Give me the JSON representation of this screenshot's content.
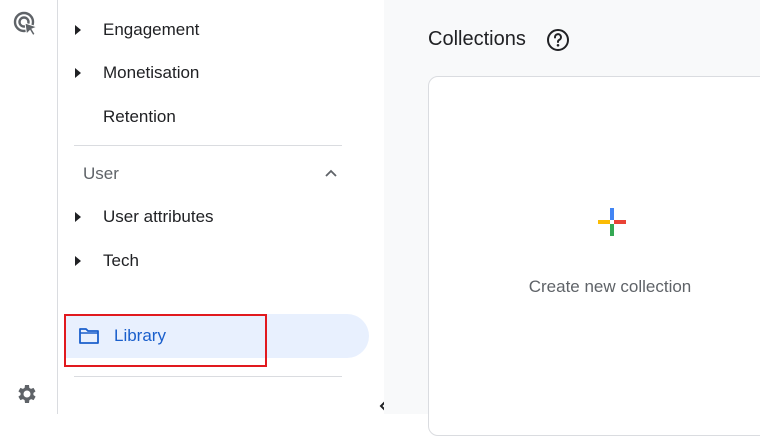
{
  "nav": {
    "items_top": [
      {
        "label": "Engagement",
        "expandable": true
      },
      {
        "label": "Monetisation",
        "expandable": true
      },
      {
        "label": "Retention",
        "expandable": false
      }
    ],
    "section": {
      "label": "User",
      "expanded": true
    },
    "items_user": [
      {
        "label": "User attributes",
        "expandable": true
      },
      {
        "label": "Tech",
        "expandable": true
      }
    ],
    "library": {
      "label": "Library",
      "selected": true
    }
  },
  "main": {
    "title": "Collections",
    "create_card": {
      "label": "Create new collection"
    }
  },
  "icons": {
    "rail_top": "analytics-cursor-icon",
    "rail_bottom": "gear-icon",
    "help": "help-circle-icon",
    "folder": "folder-icon",
    "plus": "google-plus-icon",
    "collapse": "chevron-left-icon"
  },
  "colors": {
    "selected_bg": "#e8f0fe",
    "selected_text": "#1a5fcc",
    "highlight_box": "#e1191e",
    "plus_blue": "#4285f4",
    "plus_red": "#ea4335",
    "plus_yellow": "#fbbc04",
    "plus_green": "#34a853"
  }
}
